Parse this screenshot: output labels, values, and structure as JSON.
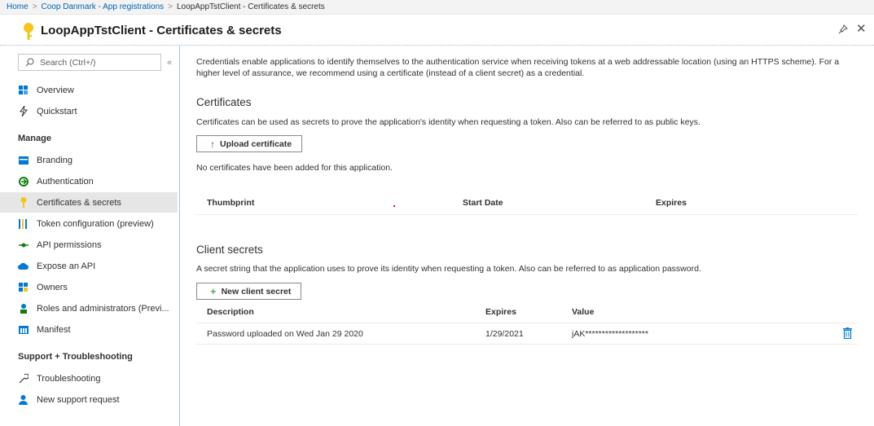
{
  "breadcrumb": {
    "items": [
      "Home",
      "Coop Danmark - App registrations"
    ],
    "current": "LoopAppTstClient - Certificates & secrets"
  },
  "header": {
    "title": "LoopAppTstClient - Certificates & secrets"
  },
  "sidebar": {
    "search_placeholder": "Search (Ctrl+/)",
    "collapse_glyph": "«",
    "top_items": [
      {
        "label": "Overview",
        "icon": "overview-icon"
      },
      {
        "label": "Quickstart",
        "icon": "quickstart-icon"
      }
    ],
    "manage_label": "Manage",
    "manage_items": [
      {
        "label": "Branding",
        "icon": "branding-icon"
      },
      {
        "label": "Authentication",
        "icon": "authentication-icon"
      },
      {
        "label": "Certificates & secrets",
        "icon": "key-icon",
        "active": true
      },
      {
        "label": "Token configuration (preview)",
        "icon": "token-icon"
      },
      {
        "label": "API permissions",
        "icon": "api-permissions-icon"
      },
      {
        "label": "Expose an API",
        "icon": "cloud-icon"
      },
      {
        "label": "Owners",
        "icon": "owners-icon"
      },
      {
        "label": "Roles and administrators (Previ...",
        "icon": "roles-icon"
      },
      {
        "label": "Manifest",
        "icon": "manifest-icon"
      }
    ],
    "support_label": "Support + Troubleshooting",
    "support_items": [
      {
        "label": "Troubleshooting",
        "icon": "wrench-icon"
      },
      {
        "label": "New support request",
        "icon": "support-person-icon"
      }
    ]
  },
  "main": {
    "intro": "Credentials enable applications to identify themselves to the authentication service when receiving tokens at a web addressable location (using an HTTPS scheme). For a higher level of assurance, we recommend using a certificate (instead of a client secret) as a credential.",
    "certificates": {
      "heading": "Certificates",
      "description": "Certificates can be used as secrets to prove the application's identity when requesting a token. Also can be referred to as public keys.",
      "upload_button": "Upload certificate",
      "empty_message": "No certificates have been added for this application.",
      "columns": [
        "Thumbprint",
        "Start Date",
        "Expires"
      ]
    },
    "client_secrets": {
      "heading": "Client secrets",
      "description": "A secret string that the application uses to prove its identity when requesting a token. Also can be referred to as application password.",
      "new_button": "New client secret",
      "columns": [
        "Description",
        "Expires",
        "Value"
      ],
      "rows": [
        {
          "description": "Password uploaded on Wed Jan 29 2020",
          "expires": "1/29/2021",
          "value": "jAK*******************"
        }
      ]
    }
  },
  "colors": {
    "accent": "#0078d4",
    "link": "#0064b4",
    "active_bg": "#e6e6e6",
    "key_yellow": "#f5c518"
  }
}
